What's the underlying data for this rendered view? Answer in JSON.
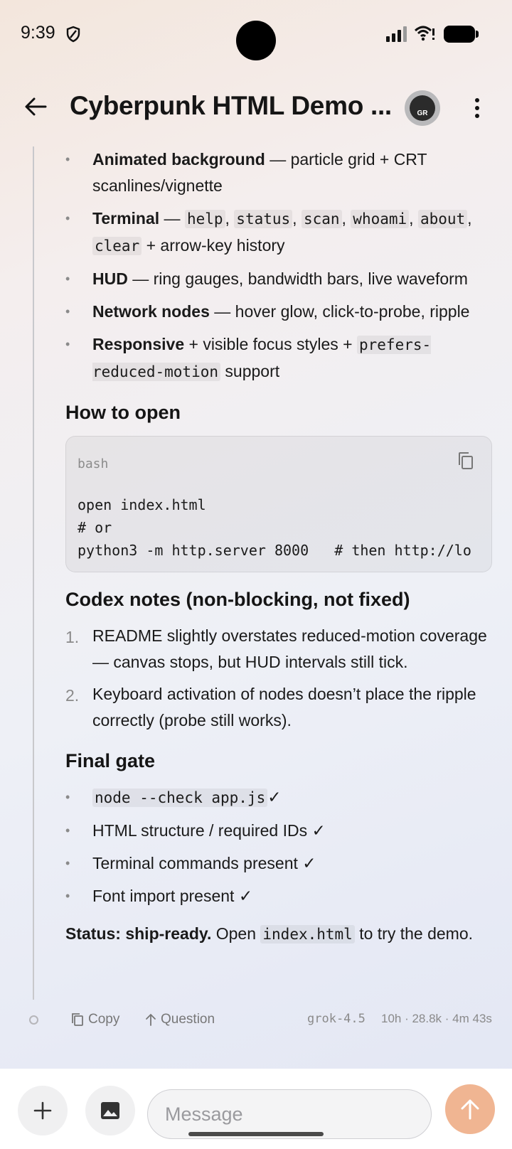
{
  "status_bar": {
    "time": "9:39"
  },
  "header": {
    "title": "Cyberpunk HTML Demo ...",
    "avatar_initials": "GR"
  },
  "features": [
    {
      "bold": "Animated background",
      "sep": " — ",
      "text": "particle grid + CRT scanlines/vignette"
    },
    {
      "bold": "Terminal",
      "sep": " — ",
      "codes": [
        "help",
        "status",
        "scan",
        "whoami",
        "about",
        "clear"
      ],
      "tail": " + arrow-key history"
    },
    {
      "bold": "HUD",
      "sep": " — ",
      "text": "ring gauges, bandwidth bars, live waveform"
    },
    {
      "bold": "Network nodes",
      "sep": " — ",
      "text": "hover glow, click-to-probe, ripple"
    },
    {
      "bold": "Responsive",
      "text": " + visible focus styles + ",
      "code": "prefers-reduced-motion",
      "tail": " support"
    }
  ],
  "how_to_open": {
    "heading": "How to open",
    "lang": "bash",
    "lines": [
      "open index.html",
      "# or",
      "python3 -m http.server 8000   # then http://lo"
    ]
  },
  "codex_notes": {
    "heading": "Codex notes (non-blocking, not fixed)",
    "items": [
      {
        "num": "1.",
        "text": "README slightly overstates reduced-motion coverage — canvas stops, but HUD intervals still tick."
      },
      {
        "num": "2.",
        "text": "Keyboard activation of nodes doesn’t place the ripple correctly (probe still works)."
      }
    ]
  },
  "final_gate": {
    "heading": "Final gate",
    "items": [
      {
        "code": "node --check app.js",
        "text": "",
        "check": "✓"
      },
      {
        "text": "HTML structure / required IDs ",
        "check": "✓"
      },
      {
        "text": "Terminal commands present ",
        "check": "✓"
      },
      {
        "text": "Font import present ",
        "check": "✓"
      }
    ]
  },
  "status": {
    "bold": "Status: ship-ready.",
    "pre": " Open ",
    "code": "index.html",
    "post": " to try the demo."
  },
  "actions": {
    "copy": "Copy",
    "question": "Question",
    "model": "grok-4.5",
    "meta": "10h · 28.8k · 4m 43s"
  },
  "composer": {
    "placeholder": "Message"
  }
}
